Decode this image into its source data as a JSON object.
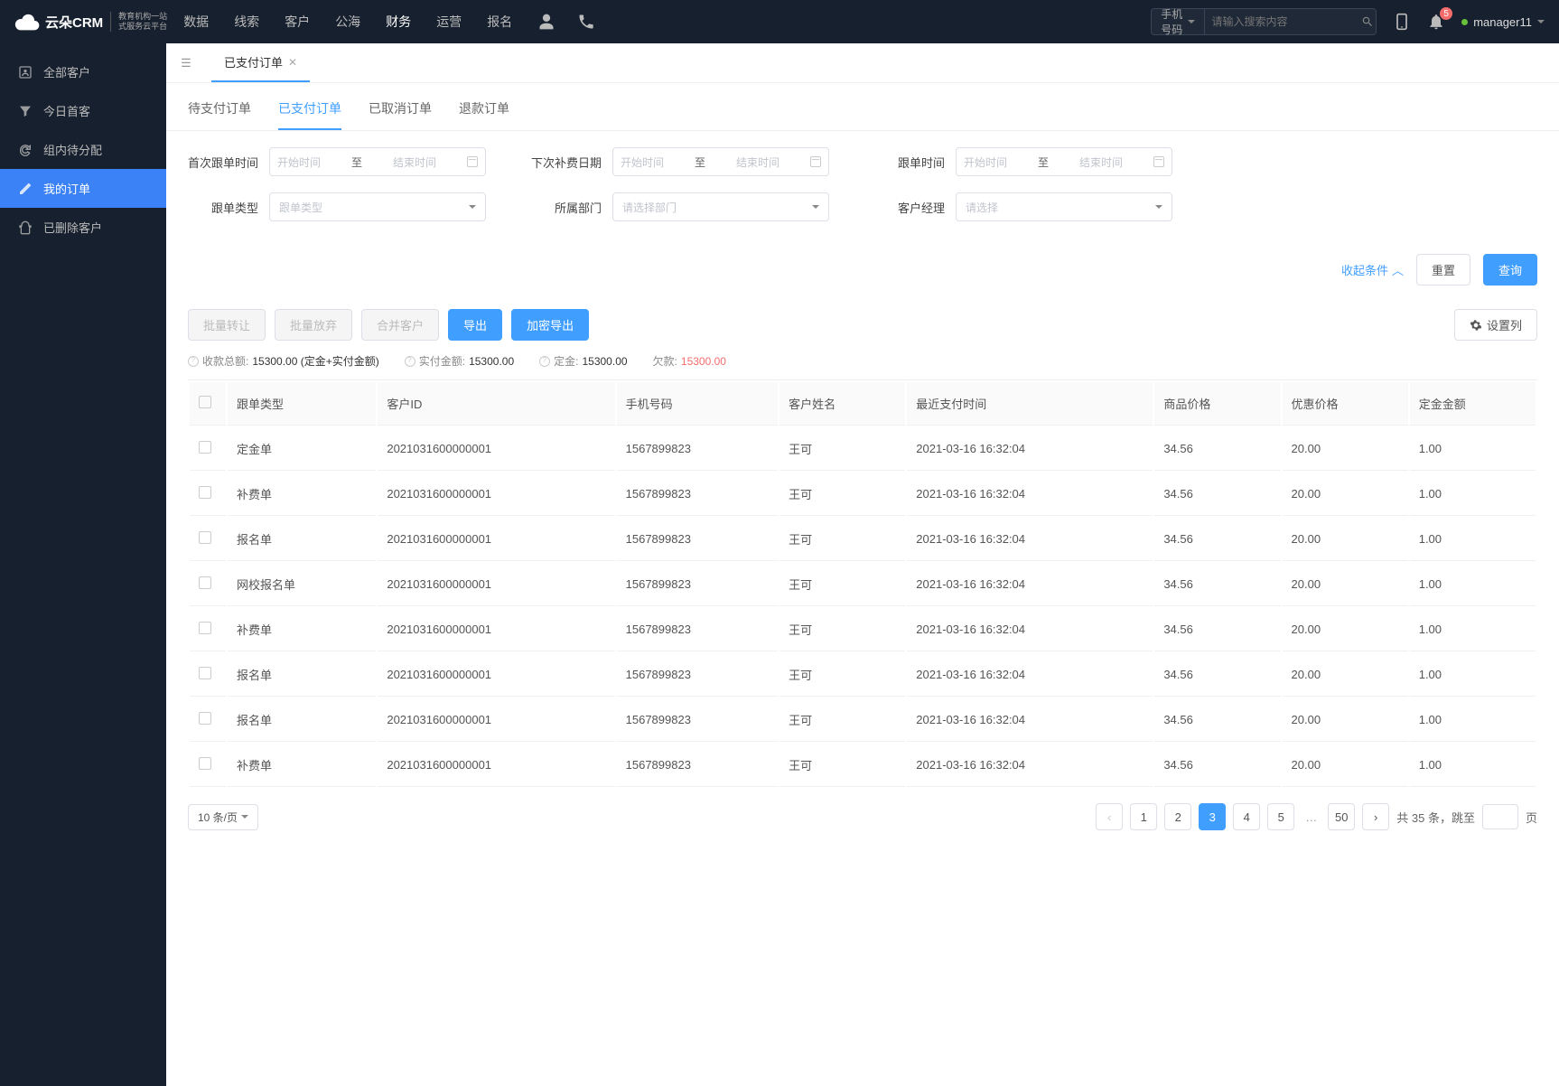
{
  "logo": {
    "name": "云朵CRM",
    "sub1": "教育机构一站",
    "sub2": "式服务云平台"
  },
  "topnav": [
    "数据",
    "线索",
    "客户",
    "公海",
    "财务",
    "运营",
    "报名"
  ],
  "topnav_active": 4,
  "search": {
    "type": "手机号码",
    "placeholder": "请输入搜索内容"
  },
  "notif_count": "5",
  "user": "manager11",
  "sidebar": [
    {
      "label": "全部客户",
      "icon": "users"
    },
    {
      "label": "今日首客",
      "icon": "filter"
    },
    {
      "label": "组内待分配",
      "icon": "refresh"
    },
    {
      "label": "我的订单",
      "icon": "edit"
    },
    {
      "label": "已删除客户",
      "icon": "trash"
    }
  ],
  "sidebar_active": 3,
  "page_tab": "已支付订单",
  "sub_tabs": [
    "待支付订单",
    "已支付订单",
    "已取消订单",
    "退款订单"
  ],
  "sub_tab_active": 1,
  "filters": {
    "first_follow_time": "首次跟单时间",
    "next_fee_date": "下次补费日期",
    "follow_time": "跟单时间",
    "start_placeholder": "开始时间",
    "end_placeholder": "结束时间",
    "sep": "至",
    "follow_type": "跟单类型",
    "follow_type_placeholder": "跟单类型",
    "dept": "所属部门",
    "dept_placeholder": "请选择部门",
    "manager": "客户经理",
    "manager_placeholder": "请选择"
  },
  "filter_buttons": {
    "collapse": "收起条件",
    "reset": "重置",
    "query": "查询"
  },
  "toolbar": {
    "batch_transfer": "批量转让",
    "batch_abandon": "批量放弃",
    "merge": "合并客户",
    "export": "导出",
    "encrypt_export": "加密导出",
    "set_columns": "设置列"
  },
  "summary": {
    "total_label": "收款总额:",
    "total_value": "15300.00 (定金+实付金额)",
    "paid_label": "实付金额:",
    "paid_value": "15300.00",
    "deposit_label": "定金:",
    "deposit_value": "15300.00",
    "owe_label": "欠款:",
    "owe_value": "15300.00"
  },
  "columns": [
    "跟单类型",
    "客户ID",
    "手机号码",
    "客户姓名",
    "最近支付时间",
    "商品价格",
    "优惠价格",
    "定金金额"
  ],
  "rows": [
    {
      "type": "定金单",
      "id": "2021031600000001",
      "phone": "1567899823",
      "name": "王可",
      "time": "2021-03-16 16:32:04",
      "price": "34.56",
      "discount": "20.00",
      "deposit": "1.00"
    },
    {
      "type": "补费单",
      "id": "2021031600000001",
      "phone": "1567899823",
      "name": "王可",
      "time": "2021-03-16 16:32:04",
      "price": "34.56",
      "discount": "20.00",
      "deposit": "1.00"
    },
    {
      "type": "报名单",
      "id": "2021031600000001",
      "phone": "1567899823",
      "name": "王可",
      "time": "2021-03-16 16:32:04",
      "price": "34.56",
      "discount": "20.00",
      "deposit": "1.00"
    },
    {
      "type": "网校报名单",
      "id": "2021031600000001",
      "phone": "1567899823",
      "name": "王可",
      "time": "2021-03-16 16:32:04",
      "price": "34.56",
      "discount": "20.00",
      "deposit": "1.00"
    },
    {
      "type": "补费单",
      "id": "2021031600000001",
      "phone": "1567899823",
      "name": "王可",
      "time": "2021-03-16 16:32:04",
      "price": "34.56",
      "discount": "20.00",
      "deposit": "1.00"
    },
    {
      "type": "报名单",
      "id": "2021031600000001",
      "phone": "1567899823",
      "name": "王可",
      "time": "2021-03-16 16:32:04",
      "price": "34.56",
      "discount": "20.00",
      "deposit": "1.00"
    },
    {
      "type": "报名单",
      "id": "2021031600000001",
      "phone": "1567899823",
      "name": "王可",
      "time": "2021-03-16 16:32:04",
      "price": "34.56",
      "discount": "20.00",
      "deposit": "1.00"
    },
    {
      "type": "补费单",
      "id": "2021031600000001",
      "phone": "1567899823",
      "name": "王可",
      "time": "2021-03-16 16:32:04",
      "price": "34.56",
      "discount": "20.00",
      "deposit": "1.00"
    }
  ],
  "pagination": {
    "page_size": "10 条/页",
    "pages": [
      "1",
      "2",
      "3",
      "4",
      "5"
    ],
    "last": "50",
    "active": "3",
    "total_prefix": "共",
    "total": "35",
    "total_suffix": "条，",
    "jump": "跳至",
    "page_suffix": "页"
  }
}
